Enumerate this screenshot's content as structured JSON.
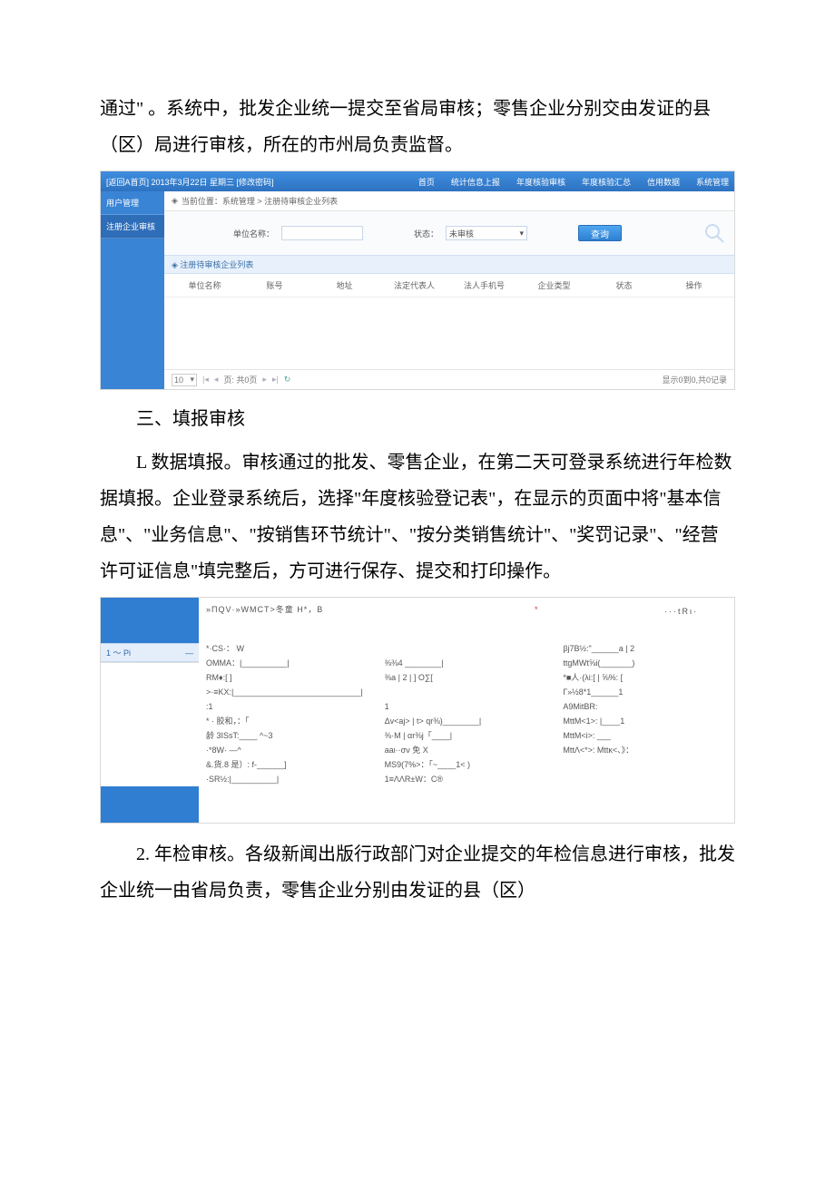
{
  "para1": "通过\" 。系统中，批发企业统一提交至省局审核；零售企业分别交由发证的县（区）局进行审核，所在的市州局负责监督。",
  "shot1": {
    "top_left": "[返回A首页]  2013年3月22日 星期三   [修改密码]",
    "nav": [
      "首页",
      "统计信息上报",
      "年度核验审核",
      "年度核验汇总",
      "信用数据",
      "系统管理"
    ],
    "sidebar": [
      "用户管理",
      "注册企业审核"
    ],
    "crumb_icon": "◈",
    "crumb": "当前位置：系统管理 > 注册待审核企业列表",
    "filter_label1": "单位名称：",
    "filter_label2": "状态：",
    "filter_status_value": "未审核",
    "query_btn": "查询",
    "list_title": "◈ 注册待审核企业列表",
    "columns": [
      "单位名称",
      "账号",
      "地址",
      "法定代表人",
      "法人手机号",
      "企业类型",
      "状态",
      "操作"
    ],
    "pager_size": "10",
    "pager_text": "页: 共0页",
    "pager_right": "显示0到0,共0记录"
  },
  "heading2": "三、填报审核",
  "para2": "L 数据填报。审核通过的批发、零售企业，在第二天可登录系统进行年检数据填报。企业登录系统后，选择\"年度核验登记表\"，在显示的页面中将\"基本信息\"、\"业务信息\"、\"按销售环节统计\"、\"按分类销售统计\"、\"奖罚记录\"、\"经营许可证信息\"填完整后，方可进行保存、提交和打印操作。",
  "shot2": {
    "title": "»ΠQV·»WMCT>冬童 H*，B",
    "right_top": "···tRι·",
    "side_tab": "1 ～ Pi",
    "rows": [
      [
        "*·CS·： W",
        "",
        "βj7B½:\"______a | 2"
      ],
      [
        "OMMA：|__________|",
        "⅜⅜4 ________|",
        "ttgMWt⅝i(_______)"
      ],
      [
        "RM♦:[            ]",
        "⅜a | 2 |      ]  O∑[",
        "*■人·(λi:[        |  ⅝%:  ["
      ],
      [
        ">·≡ΚΧ:|____________________________|",
        "",
        "Γ»½8*1______1"
      ],
      [
        ":1",
        "1",
        "A9MitBR:"
      ],
      [
        "*    ·      胶和，：「",
        "Δv<aj> | t>  qr⅜)________|",
        "MttM<1>: |____1"
      ],
      [
        "龄 3ISsT:____   ^~3",
        "⅜·M | αr⅜j「____|",
        "MttM<i>: ___"
      ],
      [
        "·*8W·        —^",
        "aaι··σν 免 X",
        "MttΛ<*>:  Mttκ<、》："
      ],
      [
        "&.货.8 是）: f-______]",
        "MS9(7%>：「~____1<    )",
        ""
      ],
      [
        "·SR½:|__________|",
        "1≡ΛΛR±W：C®",
        ""
      ]
    ]
  },
  "para3": "2. 年检审核。各级新闻出版行政部门对企业提交的年检信息进行审核，批发企业统一由省局负责，零售企业分别由发证的县（区）"
}
